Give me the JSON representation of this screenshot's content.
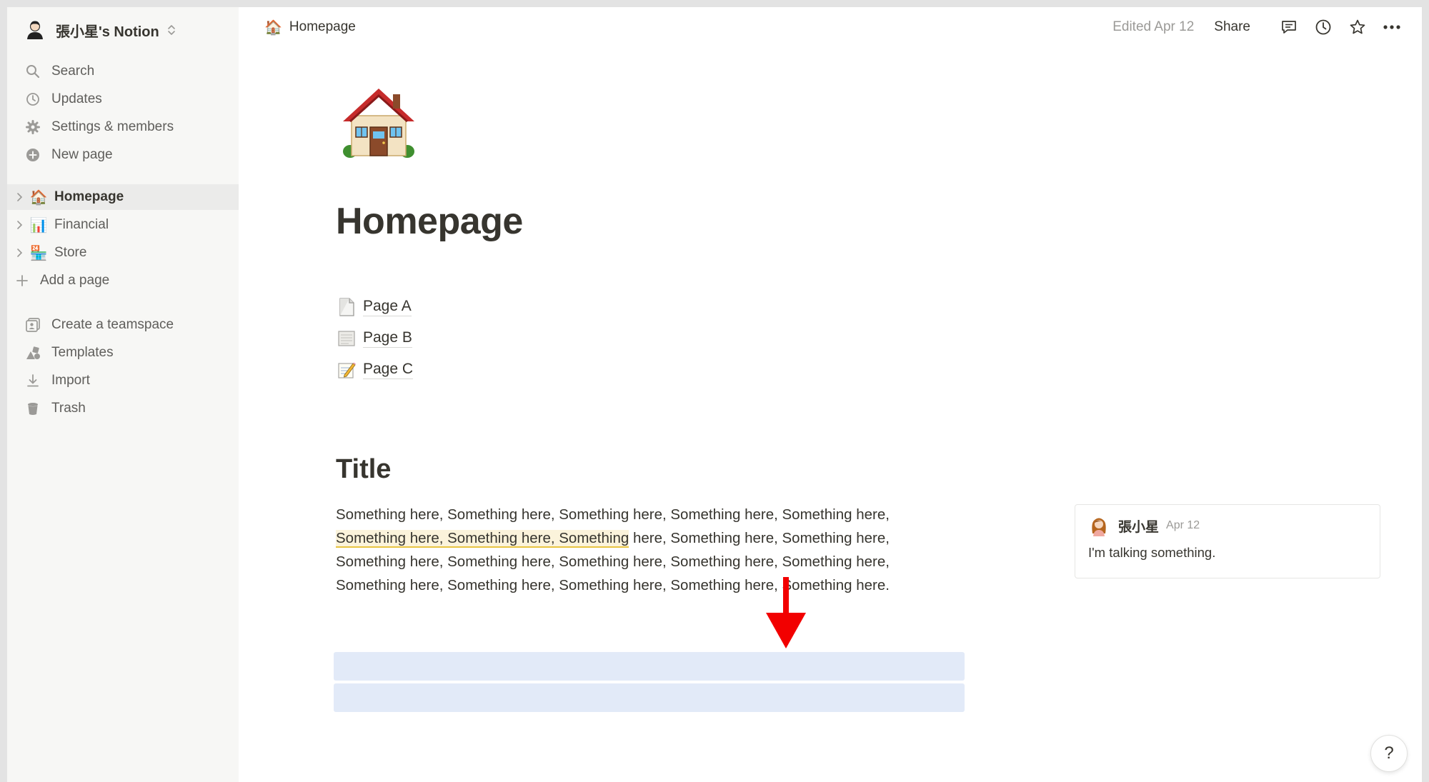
{
  "workspace": {
    "name": "張小星's Notion"
  },
  "sidebar": {
    "nav": [
      {
        "label": "Search",
        "icon": "search-icon"
      },
      {
        "label": "Updates",
        "icon": "clock-icon"
      },
      {
        "label": "Settings & members",
        "icon": "gear-icon"
      },
      {
        "label": "New page",
        "icon": "plus-circle-icon"
      }
    ],
    "pages": [
      {
        "label": "Homepage",
        "emoji": "🏠",
        "active": true
      },
      {
        "label": "Financial",
        "emoji": "📊",
        "active": false
      },
      {
        "label": "Store",
        "emoji": "🏪",
        "active": false
      }
    ],
    "add_page": "Add a page",
    "tools": [
      {
        "label": "Create a teamspace",
        "icon": "teamspace-icon"
      },
      {
        "label": "Templates",
        "icon": "templates-icon"
      },
      {
        "label": "Import",
        "icon": "import-icon"
      },
      {
        "label": "Trash",
        "icon": "trash-icon"
      }
    ]
  },
  "topbar": {
    "breadcrumb": {
      "emoji": "🏠",
      "label": "Homepage"
    },
    "edited": "Edited Apr 12",
    "share": "Share"
  },
  "page": {
    "icon": "house-icon",
    "title": "Homepage",
    "subpages": [
      {
        "label": "Page A",
        "icon": "page-icon"
      },
      {
        "label": "Page B",
        "icon": "document-icon"
      },
      {
        "label": "Page C",
        "icon": "memo-icon"
      }
    ],
    "heading": "Title",
    "paragraph_before": "Something here, Something here, Something here, Something here, Something here, ",
    "paragraph_highlight": "Something here, Something here, Something",
    "paragraph_after": " here, Something here, Something here, Something here, Something here, Something here, Something here, Something here, Something here, Something here, Something here, Something here, Something here."
  },
  "comment": {
    "author": "張小星",
    "date": "Apr 12",
    "text": "I'm talking something."
  },
  "help": {
    "label": "?"
  },
  "colors": {
    "sidebar_bg": "#f7f7f5",
    "selection_blue": "#e2eaf8",
    "highlight_yellow": "#fbf3db",
    "arrow_red": "#f20000"
  }
}
